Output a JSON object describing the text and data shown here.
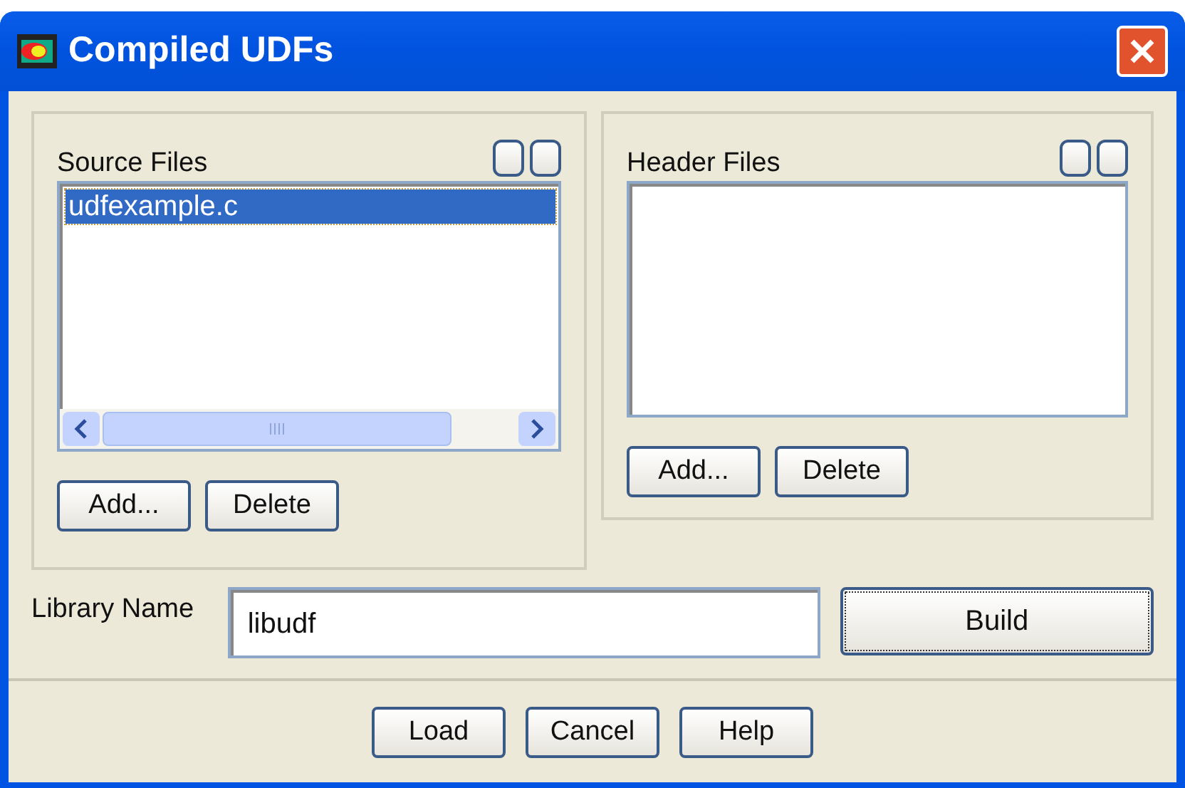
{
  "window": {
    "title": "Compiled UDFs"
  },
  "source_files": {
    "label": "Source Files",
    "items": [
      {
        "name": "udfexample.c",
        "selected": true
      }
    ],
    "buttons": [
      "Add...",
      "Delete"
    ]
  },
  "header_files": {
    "label": "Header Files",
    "buttons": [
      "Add...",
      "Delete"
    ]
  },
  "library_name": {
    "label": "Library Name",
    "value": "libudf"
  },
  "build_button": "Build",
  "buttons": [
    "Load",
    "Cancel",
    "Help"
  ]
}
